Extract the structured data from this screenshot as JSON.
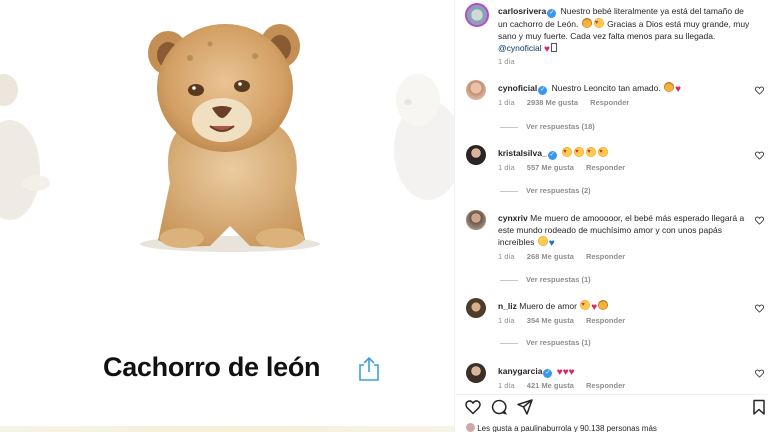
{
  "media": {
    "caption": "Cachorro de león"
  },
  "post": {
    "author": "carlosrivera",
    "caption": "Nuestro bebé literalmente ya está del tamaño de un cachorro de León.",
    "caption_2": "Gracias a Dios está muy grande, muy sano y muy fuerte. Cada vez falta menos para su llegada.",
    "mention": "@cynoficial",
    "time": "1 día"
  },
  "comments": [
    {
      "user": "cynoficial",
      "text": "Nuestro Leoncito tan amado.",
      "time": "1 día",
      "likes": "2938 Me gusta",
      "reply": "Responder",
      "view_replies": "Ver respuestas (18)"
    },
    {
      "user": "kristalsilva_",
      "text": "",
      "time": "1 día",
      "likes": "557 Me gusta",
      "reply": "Responder",
      "view_replies": "Ver respuestas (2)"
    },
    {
      "user": "cynxriv",
      "text": "Me muero de amooooor, el bebé más esperado llegará a este mundo rodeado de muchísimo amor y con unos papás increíbles",
      "time": "1 día",
      "likes": "268 Me gusta",
      "reply": "Responder",
      "view_replies": "Ver respuestas (1)"
    },
    {
      "user": "n_liz",
      "text": "Muero de amor",
      "time": "1 día",
      "likes": "354 Me gusta",
      "reply": "Responder",
      "view_replies": "Ver respuestas (1)"
    },
    {
      "user": "kanygarcia",
      "text": "",
      "time": "1 día",
      "likes": "421 Me gusta",
      "reply": "Responder"
    }
  ],
  "footer": {
    "likes_text": "Les gusta a paulinaburrola y 90.138 personas más"
  },
  "icons": {
    "like": "heart-icon",
    "comment": "comment-icon",
    "share": "send-icon",
    "save": "bookmark-icon",
    "media_share": "share-upload-icon"
  },
  "colors": {
    "verified": "#3897f0",
    "mention": "#00376b",
    "muted": "#8e8e8e",
    "share_icon": "#3aa0e0"
  }
}
